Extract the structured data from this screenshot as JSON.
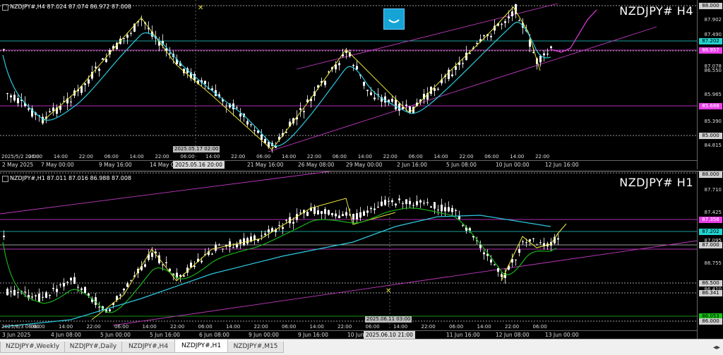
{
  "pane1": {
    "info": "NZDJPY#,H4  87.024 87.074 86.972 87.008",
    "big_title": "NZDJPY# H4",
    "price_ticks": [
      "87.902",
      "87.490",
      "87.078",
      "86.550",
      "85.965",
      "85.390",
      "84.815"
    ],
    "price_labels": [
      {
        "text": "88.000",
        "color": "#cfcfcf",
        "fg": "#000"
      },
      {
        "text": "87.202",
        "color": "#22d3cf",
        "fg": "#000"
      },
      {
        "text": "86.957",
        "color": "#e83ee8",
        "fg": "#fff"
      },
      {
        "text": "85.688",
        "color": "#e83ee8",
        "fg": "#fff"
      },
      {
        "text": "85.000",
        "color": "#cfcfcf",
        "fg": "#000"
      }
    ],
    "time_labels": [
      "2 May 2025",
      "7 May 00:00",
      "9 May 16:00",
      "14 May 0",
      "21 May 16:00",
      "26 May 08:00",
      "29 May 00:00",
      "2 Jun 16:00",
      "5 Jun 08:00",
      "10 Jun 00:00",
      "12 Jun 16:00"
    ],
    "cursor_time": "2025.05.16 20:00",
    "marker_label": "2025.05.17 02:00",
    "marker_times": [
      "2025/5/2 22:00",
      "06:00",
      "14:00",
      "22:00",
      "06:00",
      "14:00",
      "22:00",
      "06:00",
      "14:00",
      "22:00",
      "06:00",
      "14:00",
      "22:00",
      "06:00",
      "14:00",
      "22:00",
      "06:00",
      "14:00",
      "22:00",
      "06:00",
      "14:00",
      "22:00"
    ]
  },
  "pane2": {
    "info": "NZDJPY#,H1  87.011 87.016 86.988 87.008",
    "big_title": "NZDJPY# H1",
    "price_ticks": [
      "87.710",
      "87.425",
      "87.095",
      "86.755",
      "86.410"
    ],
    "price_labels": [
      {
        "text": "88.000",
        "color": "#cfcfcf",
        "fg": "#000"
      },
      {
        "text": "87.358",
        "color": "#e83ee8",
        "fg": "#fff"
      },
      {
        "text": "87.202",
        "color": "#22d3cf",
        "fg": "#000"
      },
      {
        "text": "87.000",
        "color": "#cfcfcf",
        "fg": "#000"
      },
      {
        "text": "86.500",
        "color": "#cfcfcf",
        "fg": "#000"
      },
      {
        "text": "86.341",
        "color": "#cfcfcf",
        "fg": "#000"
      },
      {
        "text": "86.053",
        "color": "#19c019",
        "fg": "#000"
      },
      {
        "text": "86.000",
        "color": "#cfcfcf",
        "fg": "#000"
      }
    ],
    "time_labels": [
      "3 Jun 2025",
      "4 Jun 08:00",
      "5 Jun 00:00",
      "5 Jun 16:00",
      "6 Jun 08:00",
      "9 Jun 00:00",
      "9 Jun 16:00",
      "10 Jun",
      "11 Jun 16:00",
      "12 Jun 08:00",
      "13 Jun 00:00"
    ],
    "cursor_time": "2025.06.10 21:00",
    "marker_label": "2025.06.11 03:00",
    "marker_times": [
      "2025/6/3 06:00",
      "06:00",
      "14:00",
      "22:00",
      "06:00",
      "14:00",
      "22:00",
      "06:00",
      "14:00",
      "22:00",
      "06:00",
      "14:00",
      "22:00",
      "06:00",
      "14:00",
      "22:00",
      "06:00",
      "14:00",
      "22:00",
      "06:00"
    ]
  },
  "tabs": [
    "NZDJPY#,Weekly",
    "NZDJPY#,Daily",
    "NZDJPY#,H4",
    "NZDJPY#,H1",
    "NZDJPY#,M15"
  ],
  "active_tab": "NZDJPY#,H1",
  "tab_arrow": "◂▸"
}
